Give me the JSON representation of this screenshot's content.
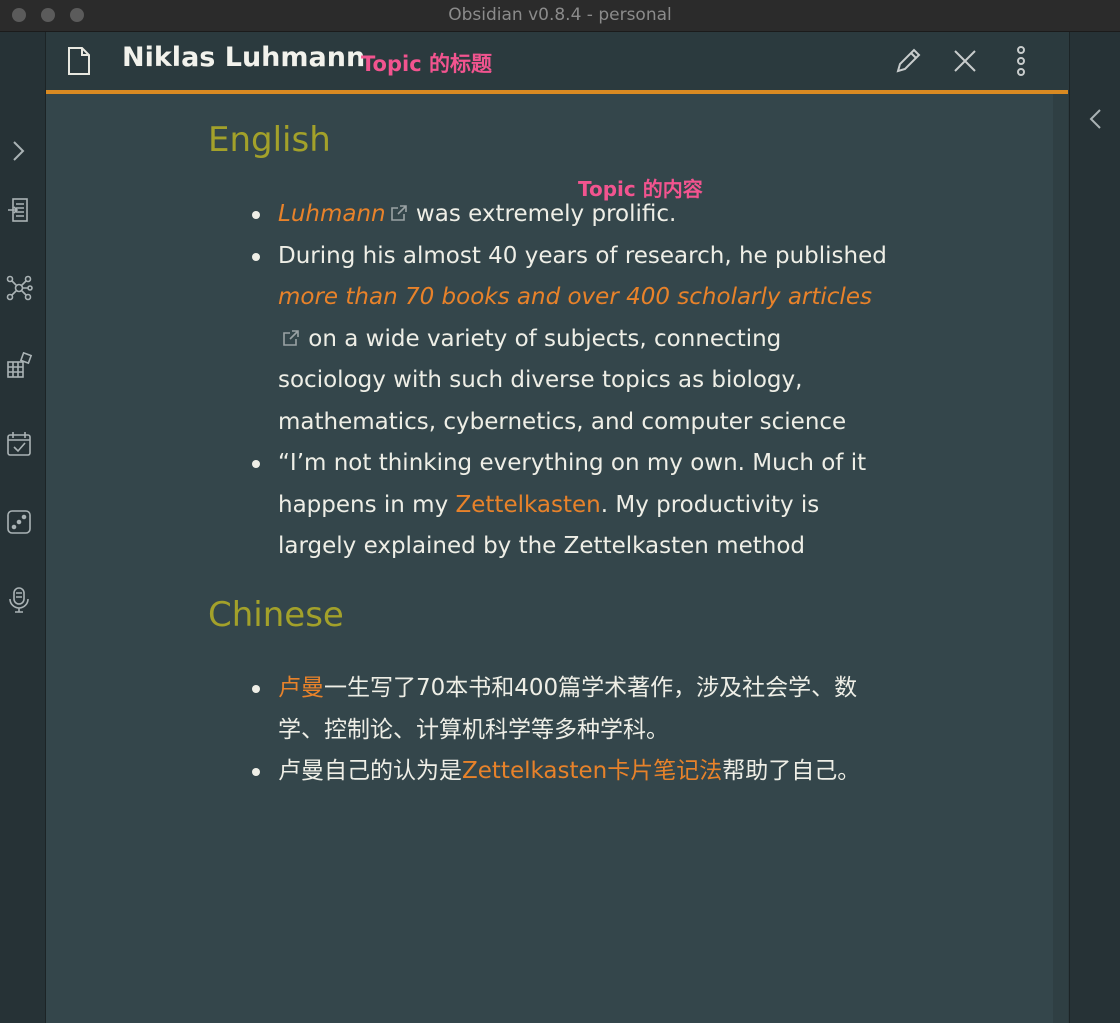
{
  "window": {
    "title": "Obsidian v0.8.4 - personal"
  },
  "colors": {
    "accent": "#d98a22",
    "link": "#e8822a",
    "heading": "#a3a12a",
    "annotation": "#f2548f"
  },
  "ribbon": {
    "left_icons": [
      "expand-right-icon",
      "quick-switcher-icon",
      "graph-view-icon",
      "plugins-icon",
      "daily-note-icon",
      "random-note-icon",
      "audio-recorder-icon"
    ],
    "right_icons": [
      "expand-left-icon"
    ]
  },
  "pane": {
    "title": "Niklas Luhmann",
    "title_annotation": "Topic 的标题",
    "content_annotation": "Topic 的内容",
    "actions": [
      "edit-icon",
      "close-icon",
      "more-options-icon"
    ]
  },
  "content": {
    "english": {
      "heading": "English",
      "item1": {
        "link": "Luhmann",
        "text": " was extremely prolific."
      },
      "item2": {
        "pre": "During his almost 40 years of research, he published ",
        "link": "more than 70 books and over 400 scholarly articles",
        "post": " on a wide variety of subjects, connecting sociology with such diverse topics as biology, mathematics, cybernetics, and computer science"
      },
      "item3": {
        "pre": "“I’m not thinking everything on my own. Much of it happens in my ",
        "link": "Zettelkasten",
        "post": ". My productivity is largely explained by the Zettelkasten method"
      }
    },
    "chinese": {
      "heading": "Chinese",
      "item1": {
        "link": "卢曼",
        "text": "一生写了70本书和400篇学术著作，涉及社会学、数学、控制论、计算机科学等多种学科。"
      },
      "item2": {
        "pre": "卢曼自己的认为是",
        "link": "Zettelkasten卡片笔记法",
        "post": "帮助了自己。"
      }
    }
  }
}
